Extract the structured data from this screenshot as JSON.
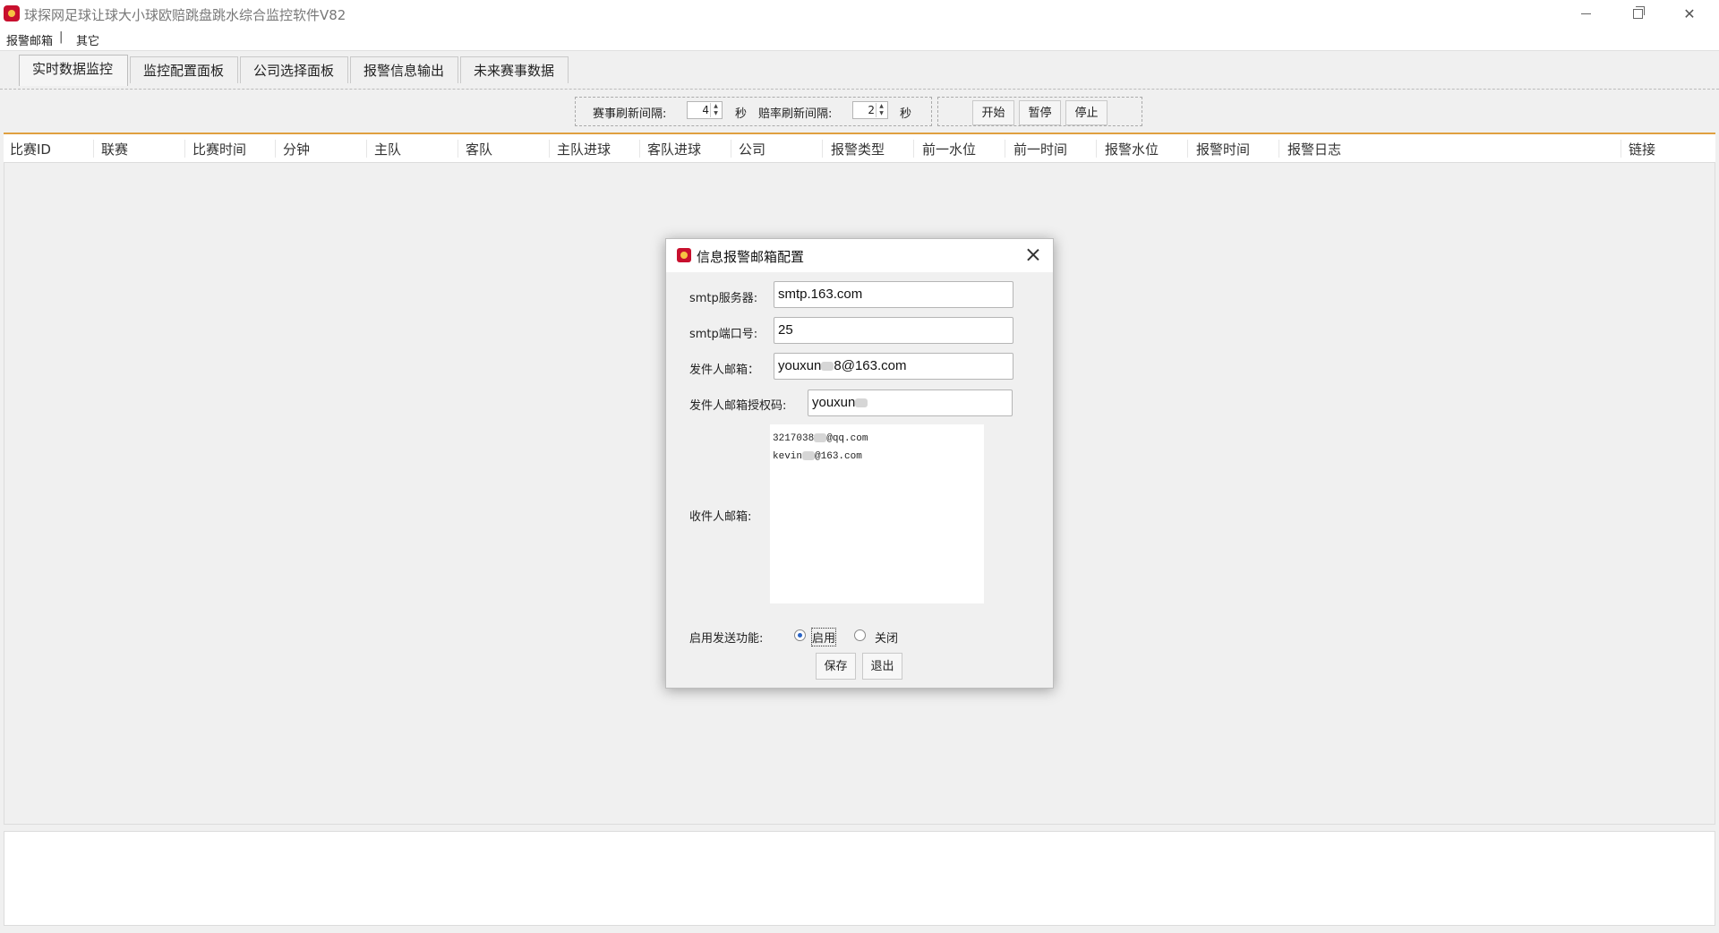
{
  "window": {
    "title": "球探网足球让球大小球欧赔跳盘跳水综合监控软件V82"
  },
  "menu": {
    "items": [
      "报警邮箱",
      "其它"
    ],
    "separator": "|"
  },
  "tabs": [
    {
      "label": "实时数据监控",
      "active": true
    },
    {
      "label": "监控配置面板",
      "active": false
    },
    {
      "label": "公司选择面板",
      "active": false
    },
    {
      "label": "报警信息输出",
      "active": false
    },
    {
      "label": "未来赛事数据",
      "active": false
    }
  ],
  "toolbar": {
    "match_refresh_label": "赛事刷新间隔:",
    "match_refresh_value": "4",
    "odds_refresh_label": "赔率刷新间隔:",
    "odds_refresh_value": "2",
    "unit": "秒",
    "start": "开始",
    "pause": "暂停",
    "stop": "停止"
  },
  "table": {
    "columns": [
      "比赛ID",
      "联赛",
      "比赛时间",
      "分钟",
      "主队",
      "客队",
      "主队进球",
      "客队进球",
      "公司",
      "报警类型",
      "前一水位",
      "前一时间",
      "报警水位",
      "报警时间",
      "报警日志",
      "链接"
    ],
    "rows": []
  },
  "dialog": {
    "title": "信息报警邮箱配置",
    "smtp_server_label": "smtp服务器:",
    "smtp_server_value": "smtp.163.com",
    "smtp_port_label": "smtp端口号:",
    "smtp_port_value": "25",
    "sender_label": "发件人邮箱：",
    "sender_value_prefix": "youxun",
    "sender_value_suffix": "8@163.com",
    "auth_label": "发件人邮箱授权码:",
    "auth_value_prefix": "youxun",
    "recipients_label": "收件人邮箱:",
    "recipients": [
      {
        "prefix": "3217038",
        "suffix": "@qq.com"
      },
      {
        "prefix": "kevin",
        "suffix": "@163.com"
      }
    ],
    "enable_label": "启用发送功能:",
    "enable_on": "启用",
    "enable_off": "关闭",
    "enabled": true,
    "save": "保存",
    "exit": "退出"
  }
}
